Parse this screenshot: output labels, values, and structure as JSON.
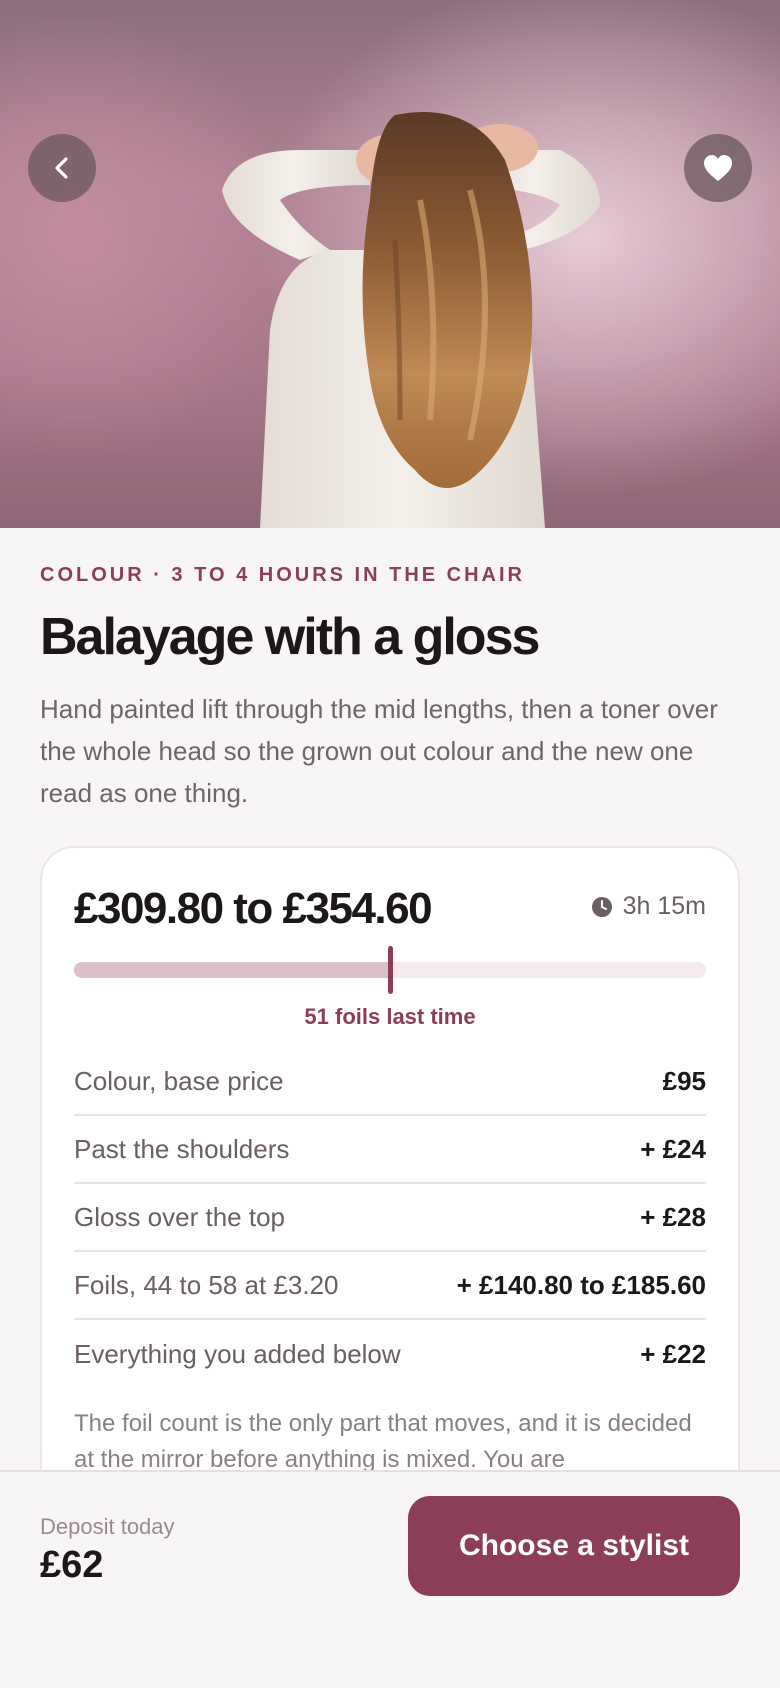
{
  "hero": {
    "image": "woman-with-long-balayage-hair-from-behind",
    "back_icon": "chevron-left-icon",
    "favorite_icon": "heart-icon"
  },
  "service": {
    "eyebrow": "COLOUR · 3 TO 4 HOURS IN THE CHAIR",
    "title": "Balayage with a gloss",
    "description": "Hand painted lift through the mid lengths, then a toner over the whole head so the grown out colour and the new one read as one thing."
  },
  "pricing": {
    "range": "£309.80 to £354.60",
    "duration_icon": "clock-icon",
    "duration": "3h 15m",
    "foils_range": {
      "min": 44,
      "max": 58,
      "last_time": 51
    },
    "foils_label": "51 foils last time",
    "rows": [
      {
        "label": "Colour, base price",
        "amount": "£95"
      },
      {
        "label": "Past the shoulders",
        "amount": "+ £24"
      },
      {
        "label": "Gloss over the top",
        "amount": "+ £28"
      },
      {
        "label": "Foils, 44 to 58 at £3.20",
        "amount": "+ £140.80 to £185.60"
      },
      {
        "label": "Everything you added below",
        "amount": "+ £22"
      }
    ],
    "note": "The foil count is the only part that moves, and it is decided at the mirror before anything is mixed. You are"
  },
  "footer": {
    "deposit_label": "Deposit today",
    "deposit_value": "£62",
    "cta_label": "Choose a stylist"
  },
  "colors": {
    "accent": "#8c3d58",
    "background": "#f8f6f5"
  }
}
